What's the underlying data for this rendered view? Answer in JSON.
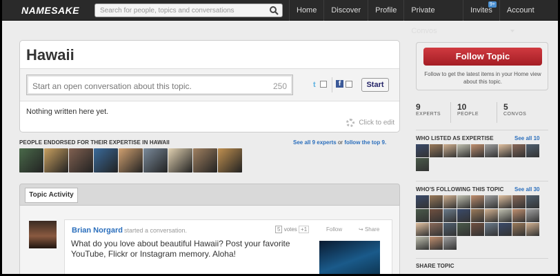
{
  "nav": {
    "logo": "NAMESAKE",
    "search_placeholder": "Search for people, topics and conversations",
    "links": [
      "Home",
      "Discover",
      "Profile",
      "Private Convos",
      "Invites",
      "Account"
    ],
    "invites_badge": "9+"
  },
  "topic": {
    "title": "Hawaii",
    "post_placeholder": "Start an open conversation about this topic.",
    "char_count": "250",
    "start_label": "Start",
    "twitter_glyph": "t",
    "facebook_glyph": "f",
    "description": "Nothing written here yet.",
    "click_to_edit": "Click to edit"
  },
  "experts": {
    "heading": "PEOPLE ENDORSED FOR THEIR EXPERTISE IN HAWAII",
    "see_all": "See all 9 experts",
    "or": "or",
    "follow_top": "follow the top 9.",
    "avatar_colors": [
      "#4a6a4a",
      "#c8a060",
      "#806050",
      "#3a6a9a",
      "#d0a070",
      "#7a8a9a",
      "#e0d0b0",
      "#a08060",
      "#c09050"
    ]
  },
  "tabs": {
    "active": "Topic Activity"
  },
  "feed": {
    "author": "Brian Norgard",
    "action": "started a conversation.",
    "votes_count": "5",
    "votes_label": "votes",
    "votes_plus": "+1",
    "follow": "Follow",
    "share": "Share",
    "message": "What do you love about beautiful Hawaii? Post your favorite YouTube, Flickr or Instagram memory. Aloha!"
  },
  "sidebar": {
    "follow_button": "Follow Topic",
    "follow_note": "Follow to get the latest items in your Home view about this topic.",
    "stats": [
      {
        "num": "9",
        "label": "EXPERTS"
      },
      {
        "num": "10",
        "label": "PEOPLE"
      },
      {
        "num": "5",
        "label": "CONVOS"
      }
    ],
    "expertise_heading": "WHO LISTED AS EXPERTISE",
    "expertise_see_all": "See all 10",
    "following_heading": "WHO'S FOLLOWING THIS TOPIC",
    "following_see_all": "See all 30",
    "share_heading": "SHARE TOPIC"
  }
}
